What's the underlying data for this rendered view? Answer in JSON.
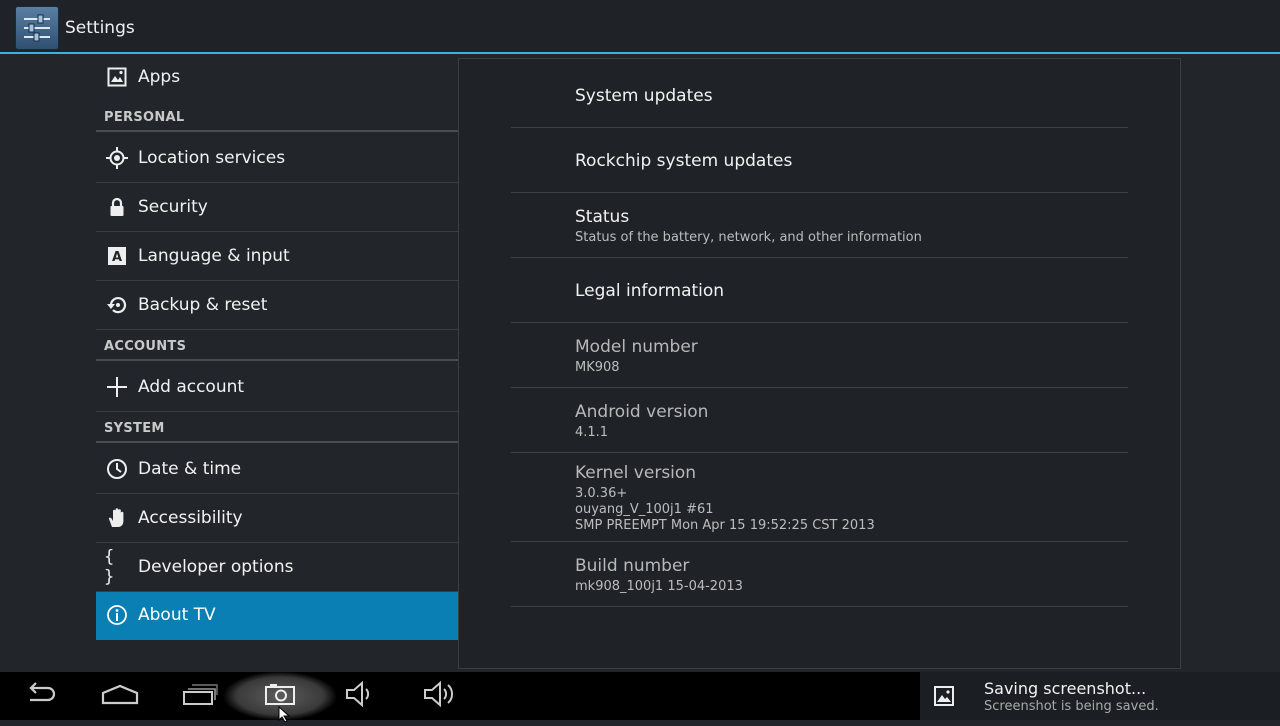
{
  "header": {
    "title": "Settings",
    "icon": "settings-sliders-icon"
  },
  "sidebar": {
    "items": [
      {
        "label": "Apps",
        "icon": "apps-icon"
      },
      {
        "section": "PERSONAL"
      },
      {
        "label": "Location services",
        "icon": "location-icon"
      },
      {
        "label": "Security",
        "icon": "lock-icon"
      },
      {
        "label": "Language & input",
        "icon": "language-icon"
      },
      {
        "label": "Backup & reset",
        "icon": "backup-icon"
      },
      {
        "section": "ACCOUNTS"
      },
      {
        "label": "Add account",
        "icon": "plus-icon"
      },
      {
        "section": "SYSTEM"
      },
      {
        "label": "Date & time",
        "icon": "clock-icon"
      },
      {
        "label": "Accessibility",
        "icon": "hand-icon"
      },
      {
        "label": "Developer options",
        "icon": "braces-icon"
      },
      {
        "label": "About TV",
        "icon": "info-icon",
        "selected": true
      }
    ]
  },
  "about": {
    "items": [
      {
        "title": "System updates"
      },
      {
        "title": "Rockchip system updates"
      },
      {
        "title": "Status",
        "summary": "Status of the battery, network, and other information"
      },
      {
        "title": "Legal information"
      },
      {
        "title": "Model number",
        "summary": "MK908"
      },
      {
        "title": "Android version",
        "summary": "4.1.1"
      },
      {
        "title": "Kernel version",
        "summary_lines": [
          "3.0.36+",
          "ouyang_V_100j1 #61",
          "SMP PREEMPT Mon Apr 15 19:52:25 CST 2013"
        ]
      },
      {
        "title": "Build number",
        "summary": "mk908_100j1 15-04-2013"
      }
    ]
  },
  "navbar": {
    "buttons": [
      "back-icon",
      "home-icon",
      "recent-apps-icon",
      "screenshot-icon",
      "volume-down-icon",
      "volume-up-icon"
    ]
  },
  "notification": {
    "title": "Saving screenshot...",
    "text": "Screenshot is being saved.",
    "icon": "image-icon"
  },
  "colors": {
    "accent": "#33b5e5",
    "selected": "#0a7fb3",
    "background": "#22262b"
  }
}
